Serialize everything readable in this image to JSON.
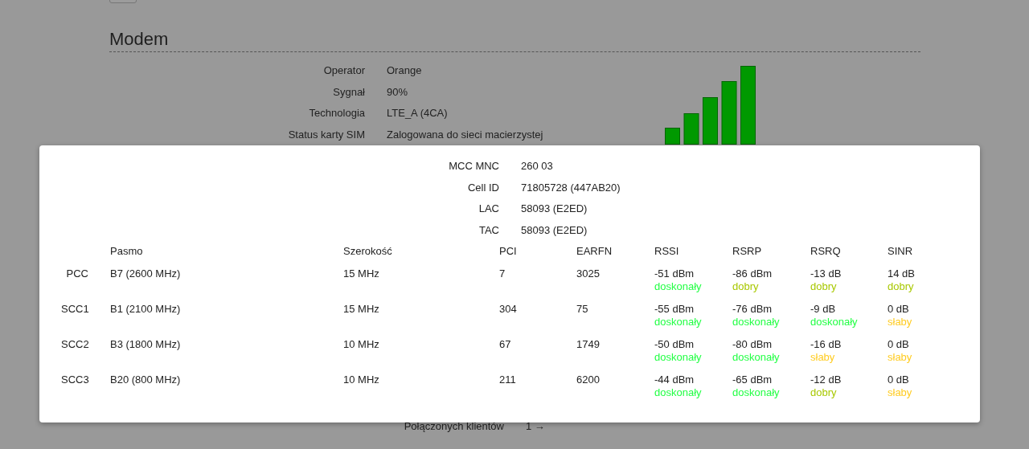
{
  "page": {
    "heading": "Modem",
    "info": [
      {
        "label": "Operator",
        "value": "Orange"
      },
      {
        "label": "Sygnał",
        "value": "90%"
      },
      {
        "label": "Technologia",
        "value": "LTE_A (4CA)"
      },
      {
        "label": "Status karty SIM",
        "value": "Zalogowana do sieci macierzystej"
      }
    ],
    "bottom_info": [
      {
        "label": "Połączonych klientów",
        "value": "1 →"
      }
    ]
  },
  "dialog": {
    "info": [
      {
        "label": "MCC MNC",
        "value": "260 03"
      },
      {
        "label": "Cell ID",
        "value": "71805728 (447AB20)"
      },
      {
        "label": "LAC",
        "value": "58093 (E2ED)"
      },
      {
        "label": "TAC",
        "value": "58093 (E2ED)"
      }
    ],
    "table": {
      "columns": [
        "Pasmo",
        "Szerokość",
        "PCI",
        "EARFN",
        "RSSI",
        "RSRP",
        "RSRQ",
        "SINR"
      ],
      "rows": [
        {
          "carrier": "PCC",
          "band": "B7 (2600 MHz)",
          "width": "15 MHz",
          "pci": "7",
          "earfn": "3025",
          "signals": [
            {
              "value": "-51 dBm",
              "quality": "doskonały",
              "color": "#22ff44"
            },
            {
              "value": "-86 dBm",
              "quality": "dobry",
              "color": "#a8c800"
            },
            {
              "value": "-13 dB",
              "quality": "dobry",
              "color": "#a8c800"
            },
            {
              "value": "14 dB",
              "quality": "dobry",
              "color": "#a8c800"
            }
          ]
        },
        {
          "carrier": "SCC1",
          "band": "B1 (2100 MHz)",
          "width": "15 MHz",
          "pci": "304",
          "earfn": "75",
          "signals": [
            {
              "value": "-55 dBm",
              "quality": "doskonały",
              "color": "#22ff44"
            },
            {
              "value": "-76 dBm",
              "quality": "doskonały",
              "color": "#22ff44"
            },
            {
              "value": "-9 dB",
              "quality": "doskonały",
              "color": "#22ff44"
            },
            {
              "value": "0 dB",
              "quality": "słaby",
              "color": "#ffcc22"
            }
          ]
        },
        {
          "carrier": "SCC2",
          "band": "B3 (1800 MHz)",
          "width": "10 MHz",
          "pci": "67",
          "earfn": "1749",
          "signals": [
            {
              "value": "-50 dBm",
              "quality": "doskonały",
              "color": "#22ff44"
            },
            {
              "value": "-80 dBm",
              "quality": "doskonały",
              "color": "#22ff44"
            },
            {
              "value": "-16 dB",
              "quality": "słaby",
              "color": "#ffcc22"
            },
            {
              "value": "0 dB",
              "quality": "słaby",
              "color": "#ffcc22"
            }
          ]
        },
        {
          "carrier": "SCC3",
          "band": "B20 (800 MHz)",
          "width": "10 MHz",
          "pci": "211",
          "earfn": "6200",
          "signals": [
            {
              "value": "-44 dBm",
              "quality": "doskonały",
              "color": "#22ff44"
            },
            {
              "value": "-65 dBm",
              "quality": "doskonały",
              "color": "#22ff44"
            },
            {
              "value": "-12 dB",
              "quality": "dobry",
              "color": "#a8c800"
            },
            {
              "value": "0 dB",
              "quality": "słaby",
              "color": "#ffcc22"
            }
          ]
        }
      ]
    }
  }
}
